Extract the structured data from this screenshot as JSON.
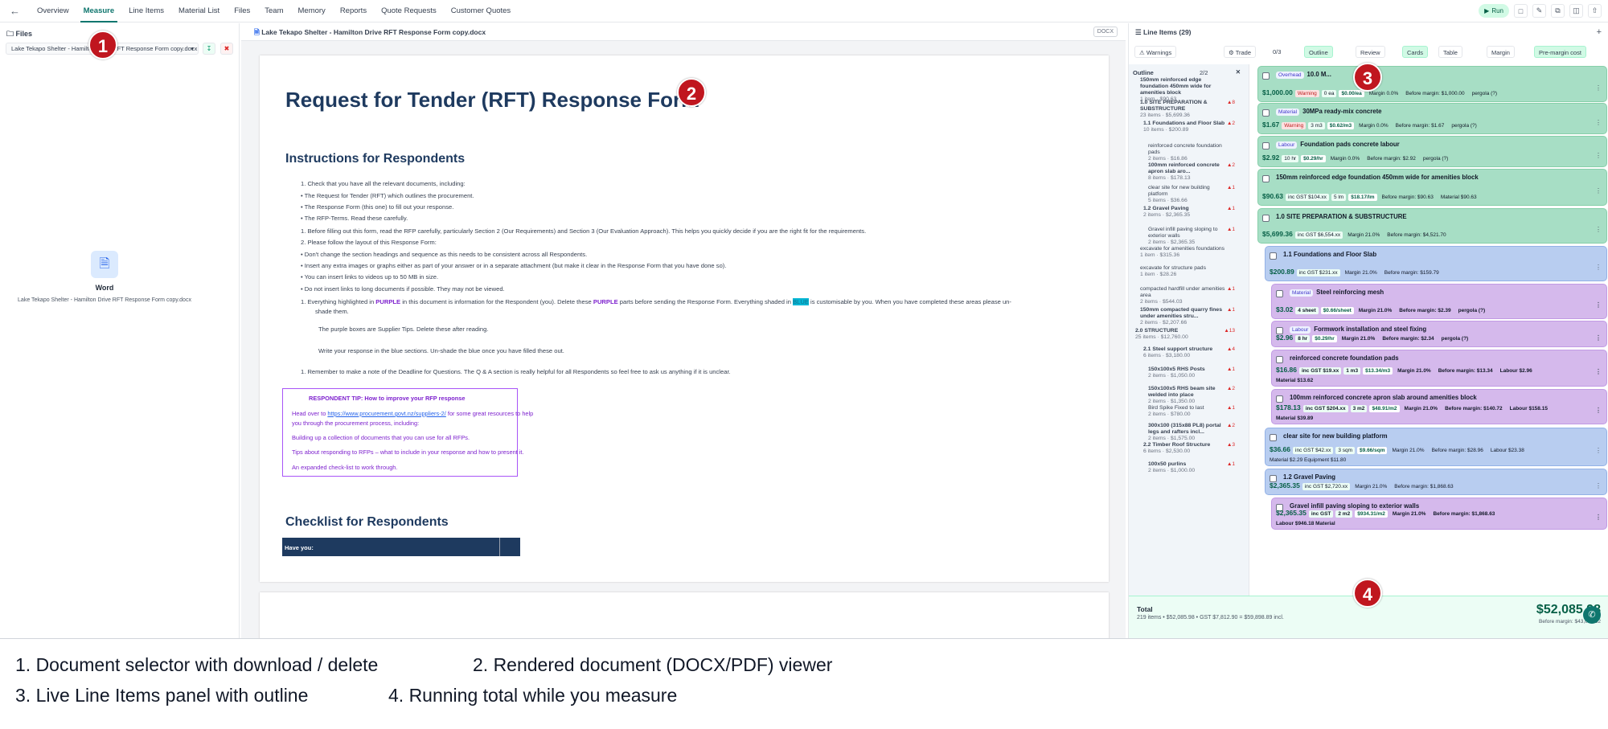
{
  "nav": {
    "tabs": [
      "Overview",
      "Measure",
      "Line Items",
      "Material List",
      "Files",
      "Team",
      "Memory",
      "Reports",
      "Quote Requests",
      "Customer Quotes"
    ],
    "active": "Measure",
    "run_label": "Run"
  },
  "files": {
    "header": "Files",
    "selected_doc": "Lake Tekapo Shelter - Hamilton Drive RFT Response Form copy.docx",
    "word_label": "Word",
    "word_filename": "Lake Tekapo Shelter - Hamilton Drive RFT Response Form copy.docx"
  },
  "doc": {
    "filename": "Lake Tekapo Shelter - Hamilton Drive RFT Response Form copy.docx",
    "badge": "DOCX",
    "title": "Request for Tender (RFT) Response Form",
    "h_instructions": "Instructions for Respondents",
    "lines": [
      "1.   Check that you have all the relevant documents, including:",
      "•   The Request for Tender (RFT) which outlines the procurement.",
      "•   The Response Form (this one) to fill out your response.",
      "•   The RFP-Terms. Read these carefully.",
      "1.   Before filling out this form, read the RFP carefully, particularly Section 2 (Our Requirements) and Section 3 (Our Evaluation Approach). This helps you quickly decide if you are the right fit for the requirements.",
      "2.   Please follow the layout of this Response Form:",
      "•   Don't change the section headings and sequence as this needs to be consistent across all Respondents.",
      "•   Insert any extra images or graphs either as part of your answer or in a separate attachment (but make it clear in the Response Form that you have done so).",
      "•   You can insert links to videos up to 50 MB in size.",
      "•   Do not insert links to long documents if possible. They may not be viewed."
    ],
    "hl_prefix": "1.   Everything highlighted in ",
    "hl_purple": "PURPLE",
    "hl_mid": " in this document is information for the Respondent (you). Delete these ",
    "hl_purple2": "PURPLE",
    "hl_mid2": " parts before sending the Response Form. Everything shaded in ",
    "hl_blue": "BLUE",
    "hl_suffix": " is customisable by you. When you have completed these areas please un-",
    "hl_cont": "shade them.",
    "purple_boxes": "The purple boxes are Supplier Tips. Delete these after reading.",
    "blue_sections": "Write your response in the blue sections. Un-shade the blue once you have filled these out.",
    "remember": "1.   Remember to make a note of the Deadline for Questions. The Q & A section is really helpful for all Respondents so feel free to ask us anything if it is unclear.",
    "tip_title": "RESPONDENT TIP: How to improve your RFP response",
    "tip_1a": "Head over to ",
    "tip_link": "https://www.procurement.govt.nz/suppliers-2/",
    "tip_1b": " for some great resources to help",
    "tip_2": "you through the procurement process, including:",
    "tip_3": "Building up a collection of documents that you can use for all RFPs.",
    "tip_4": "Tips about responding to RFPs – what to include in your response and how to present it.",
    "tip_5": "An expanded check-list to work through.",
    "h_checklist": "Checklist for Respondents",
    "table_header": "Have you:"
  },
  "panel": {
    "title": "Line Items (29)",
    "warnings": "Warnings",
    "trade": "Trade",
    "counter": "0/3",
    "outline_btn": "Outline",
    "review": "Review",
    "cards_btn": "Cards",
    "table_btn": "Table",
    "margin_btn": "Margin",
    "premargin_btn": "Pre-margin cost",
    "outline_header": "Outline",
    "outline_count": "2/2",
    "outline": [
      {
        "t": "150mm reinforced edge foundation 450mm wide for amenities block",
        "s": "1 item · $90.63",
        "w": ""
      },
      {
        "t": "1.0 SITE PREPARATION & SUBSTRUCTURE",
        "s": "23 items · $5,699.36",
        "w": "▲8"
      },
      {
        "t": "1.1 Foundations and Floor Slab",
        "s": "10 items · $200.89",
        "w": "▲2"
      },
      {
        "t": "reinforced concrete foundation pads",
        "s": "2 items · $16.86",
        "w": ""
      },
      {
        "t": "100mm reinforced concrete apron slab aro...",
        "s": "8 items · $178.13",
        "w": "▲2"
      },
      {
        "t": "clear site for new building platform",
        "s": "5 items · $36.66",
        "w": "▲1"
      },
      {
        "t": "1.2 Gravel Paving",
        "s": "2 items · $2,365.35",
        "w": "▲1"
      },
      {
        "t": "Gravel infill paving sloping to exterior walls",
        "s": "2 items · $2,365.35",
        "w": "▲1"
      },
      {
        "t": "excavate for amenities foundations",
        "s": "1 item · $315.36",
        "w": ""
      },
      {
        "t": "excavate for structure pads",
        "s": "1 item · $28.26",
        "w": ""
      },
      {
        "t": "compacted hardfill under amenities area",
        "s": "2 items · $544.03",
        "w": "▲1"
      },
      {
        "t": "150mm compacted quarry fines under amenities stru...",
        "s": "2 items · $2,207.66",
        "w": "▲1"
      },
      {
        "t": "2.0 STRUCTURE",
        "s": "25 items · $12,760.00",
        "w": "▲13"
      },
      {
        "t": "2.1 Steel support structure",
        "s": "6 items · $3,180.00",
        "w": "▲4"
      },
      {
        "t": "150x100x5 RHS Posts",
        "s": "2 items · $1,050.00",
        "w": "▲1"
      },
      {
        "t": "150x100x5 RHS beam site welded into place",
        "s": "2 items · $1,350.00",
        "w": "▲2"
      },
      {
        "t": "Bird Spike Fixed to last",
        "s": "2 items · $780.00",
        "w": "▲1"
      },
      {
        "t": "300x100 (315x88 PL8) portal legs and rafters incl...",
        "s": "2 items · $1,575.00",
        "w": "▲2"
      },
      {
        "t": "2.2 Timber Roof Structure",
        "s": "6 items · $2,530.00",
        "w": "▲3"
      },
      {
        "t": "100x50 purlins",
        "s": "2 items · $1,000.00",
        "w": "▲1"
      }
    ],
    "cards": [
      {
        "title": "10.0 M...",
        "tag": "Overhead",
        "price": "$1,000.00",
        "chips": [
          "Warning",
          "0 ea",
          "$0.00/ea"
        ],
        "margin": "Margin 0.0%",
        "before": "Before margin: $1,000.00",
        "extra": "pergola (?)",
        "color": "green"
      },
      {
        "title": "30MPa ready-mix concrete",
        "tag": "Material",
        "price": "$1.67",
        "chips": [
          "Warning",
          "3 m3",
          "$0.62/m3"
        ],
        "margin": "Margin 0.0%",
        "before": "Before margin: $1.67",
        "extra": "pergola (?)",
        "color": "green"
      },
      {
        "title": "Foundation pads concrete labour",
        "tag": "Labour",
        "price": "$2.92",
        "chips": [
          "10 hr",
          "$0.29/hr"
        ],
        "margin": "Margin 0.0%",
        "before": "Before margin: $2.92",
        "extra": "pergola (?)",
        "color": "green"
      },
      {
        "title": "150mm reinforced edge foundation 450mm wide for amenities block",
        "tag": "",
        "price": "$90.63",
        "chips": [
          "inc GST $104.xx",
          "5 lm",
          "$18.17/lm"
        ],
        "margin": "",
        "before": "Before margin: $90.63",
        "extra": "Material $90.63",
        "color": "green"
      },
      {
        "title": "1.0 SITE PREPARATION & SUBSTRUCTURE",
        "tag": "",
        "price": "$5,699.36",
        "chips": [
          "inc GST $6,554.xx"
        ],
        "margin": "Margin 21.0%",
        "before": "Before margin: $4,521.70",
        "extra": "",
        "color": "green"
      },
      {
        "title": "1.1 Foundations and Floor Slab",
        "tag": "",
        "price": "$200.89",
        "chips": [
          "inc GST $231.xx"
        ],
        "margin": "Margin 21.0%",
        "before": "Before margin: $159.79",
        "extra": "",
        "color": "blue"
      },
      {
        "title": "Steel reinforcing mesh",
        "tag": "Material",
        "price": "$3.02",
        "chips": [
          "4 sheet",
          "$0.66/sheet"
        ],
        "margin": "Margin 21.0%",
        "before": "Before margin: $2.39",
        "extra": "pergola (?)",
        "color": "purple"
      },
      {
        "title": "Formwork installation and steel fixing",
        "tag": "Labour",
        "price": "$2.96",
        "chips": [
          "8 hr",
          "$0.29/hr"
        ],
        "margin": "Margin 21.0%",
        "before": "Before margin: $2.34",
        "extra": "pergola (?)",
        "color": "purple"
      },
      {
        "title": "reinforced concrete foundation pads",
        "tag": "",
        "price": "$16.86",
        "chips": [
          "inc GST $19.xx",
          "1 m3",
          "$13.34/m3"
        ],
        "margin": "Margin 21.0%",
        "before": "Before margin: $13.34",
        "extra": "Labour $2.96",
        "extra2": "Material $13.62",
        "color": "purple"
      },
      {
        "title": "100mm reinforced concrete apron slab around amenities block",
        "tag": "",
        "price": "$178.13",
        "chips": [
          "inc GST $204.xx",
          "3 m2",
          "$48.91/m2"
        ],
        "margin": "Margin 21.0%",
        "before": "Before margin: $140.72",
        "extra": "Labour $158.15",
        "extra2": "Material $39.89",
        "color": "purple"
      },
      {
        "title": "clear site for new building platform",
        "tag": "",
        "price": "$36.66",
        "chips": [
          "inc GST $42.xx",
          "3 sqm",
          "$9.66/sqm"
        ],
        "margin": "Margin 21.0%",
        "before": "Before margin: $28.96",
        "extra": "Labour $23.38",
        "extra2": "Material $2.29  Equipment $11.80",
        "color": "blue"
      },
      {
        "title": "1.2 Gravel Paving",
        "tag": "",
        "price": "$2,365.35",
        "chips": [
          "inc GST $2,720.xx"
        ],
        "margin": "Margin 21.0%",
        "before": "Before margin: $1,868.63",
        "extra": "",
        "color": "blue"
      },
      {
        "title": "Gravel infill paving sloping to exterior walls",
        "tag": "",
        "price": "$2,365.35",
        "chips": [
          "inc GST",
          "2 m2",
          "$934.31/m2"
        ],
        "margin": "Margin 21.0%",
        "before": "Before margin: $1,868.63",
        "extra": "",
        "extra2": "Labour $946.18  Material",
        "color": "purple"
      }
    ],
    "total_label": "Total",
    "total_summary": "219 items • $52,085.98 • GST $7,812.90 = $59,898.89 incl.",
    "total_big": "$52,085.98",
    "total_before": "Before margin: $43,036.32"
  },
  "captions": {
    "c1": "1. Document selector with download / delete",
    "c2": "2. Rendered document (DOCX/PDF) viewer",
    "c3": "3. Live Line Items panel with outline",
    "c4": "4. Running total while you measure"
  },
  "markers": [
    "1",
    "2",
    "3",
    "4"
  ]
}
